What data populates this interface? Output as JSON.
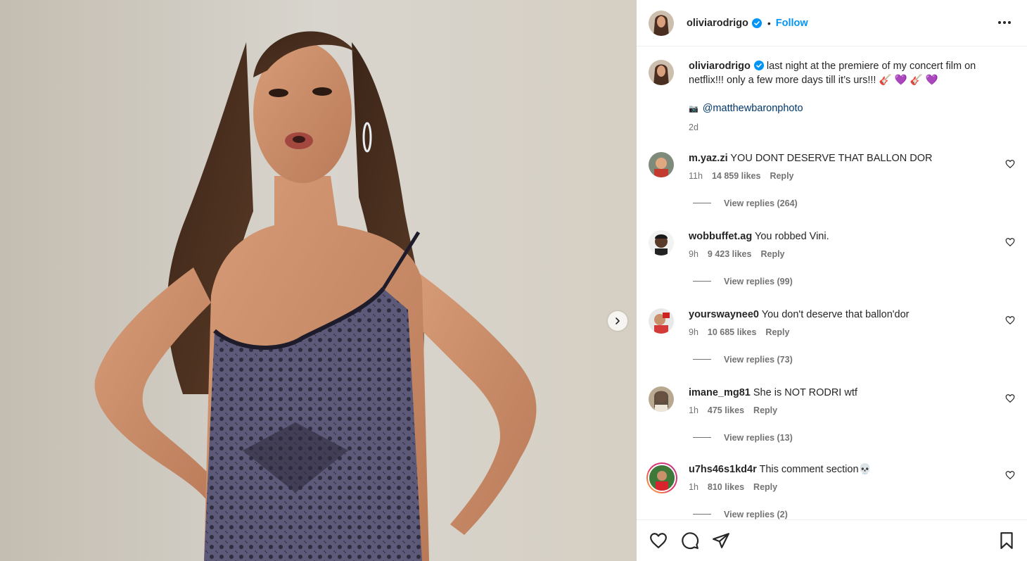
{
  "post": {
    "username": "oliviarodrigo",
    "follow_label": "Follow",
    "separator": "•",
    "caption": "last night at the premiere of my concert film on netflix!!! only a few more days till it’s urs!!! 🎸 💜 🎸 💜",
    "credit_icon": "📷",
    "credit_handle": "@matthewbaronphoto",
    "time": "2d"
  },
  "comments": [
    {
      "username": "m.yaz.zi",
      "text": "YOU DONT DESERVE THAT BALLON DOR",
      "time": "11h",
      "likes": "14 859 likes",
      "reply": "Reply",
      "replies": "View replies (264)"
    },
    {
      "username": "wobbuffet.ag",
      "text": "You robbed Vini.",
      "time": "9h",
      "likes": "9 423 likes",
      "reply": "Reply",
      "replies": "View replies (99)"
    },
    {
      "username": "yourswaynee0",
      "text": "You don't deserve that ballon'dor",
      "time": "9h",
      "likes": "10 685 likes",
      "reply": "Reply",
      "replies": "View replies (73)"
    },
    {
      "username": "imane_mg81",
      "text": "She is NOT RODRI wtf",
      "time": "1h",
      "likes": "475 likes",
      "reply": "Reply",
      "replies": "View replies (13)"
    },
    {
      "username": "u7hs46s1kd4r",
      "text": "This comment section💀",
      "time": "1h",
      "likes": "810 likes",
      "reply": "Reply",
      "replies": "View replies (2)"
    }
  ],
  "icons": {
    "verified": "verified-badge-icon",
    "more": "more-options-icon",
    "next": "chevron-right-icon",
    "like": "heart-icon",
    "comment": "comment-icon",
    "share": "share-icon",
    "save": "bookmark-icon"
  },
  "colors": {
    "accent": "#0095f6",
    "link": "#00376b",
    "secondary_text": "#737373"
  }
}
